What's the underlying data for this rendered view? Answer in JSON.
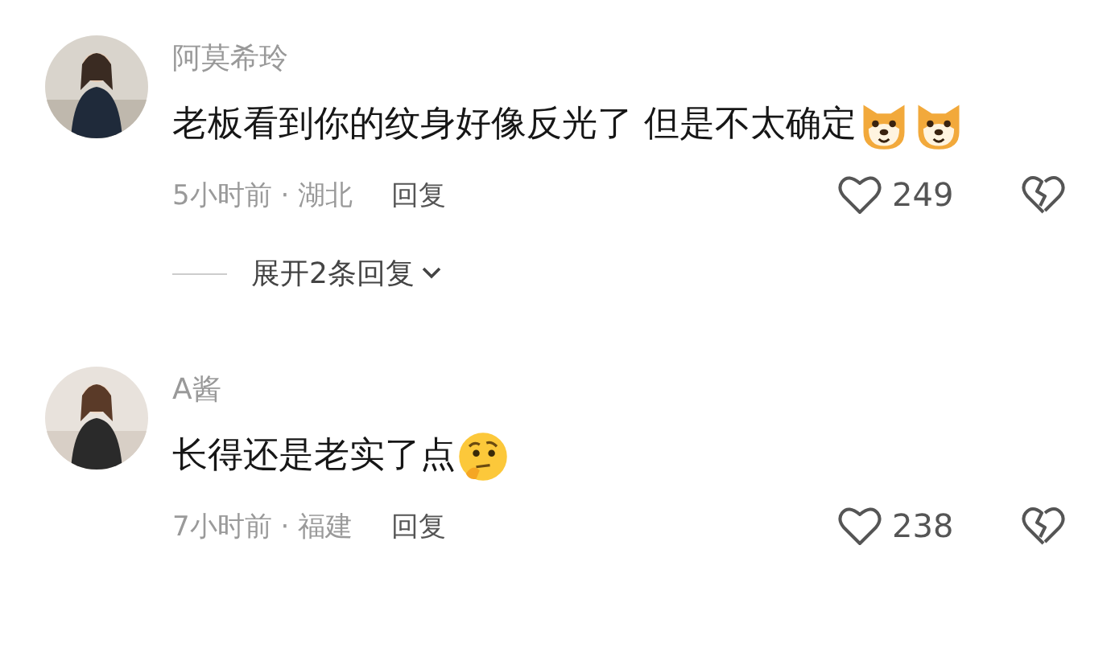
{
  "comments": [
    {
      "author": "阿莫希玲",
      "avatar": {
        "kind": "picture"
      },
      "text": "老板看到你的纹身好像反光了 但是不太确定",
      "emojis": [
        {
          "kind": "dog"
        },
        {
          "kind": "dog"
        }
      ],
      "meta": "5小时前 · 湖北",
      "reply": "回复",
      "likes": "249",
      "replies_toggle": "展开2条回复"
    },
    {
      "author": "A酱",
      "avatar": {
        "kind": "picture"
      },
      "text": "长得还是老实了点",
      "emojis": [
        {
          "kind": "thinking"
        }
      ],
      "meta": "7小时前 · 福建",
      "reply": "回复",
      "likes": "238"
    }
  ]
}
